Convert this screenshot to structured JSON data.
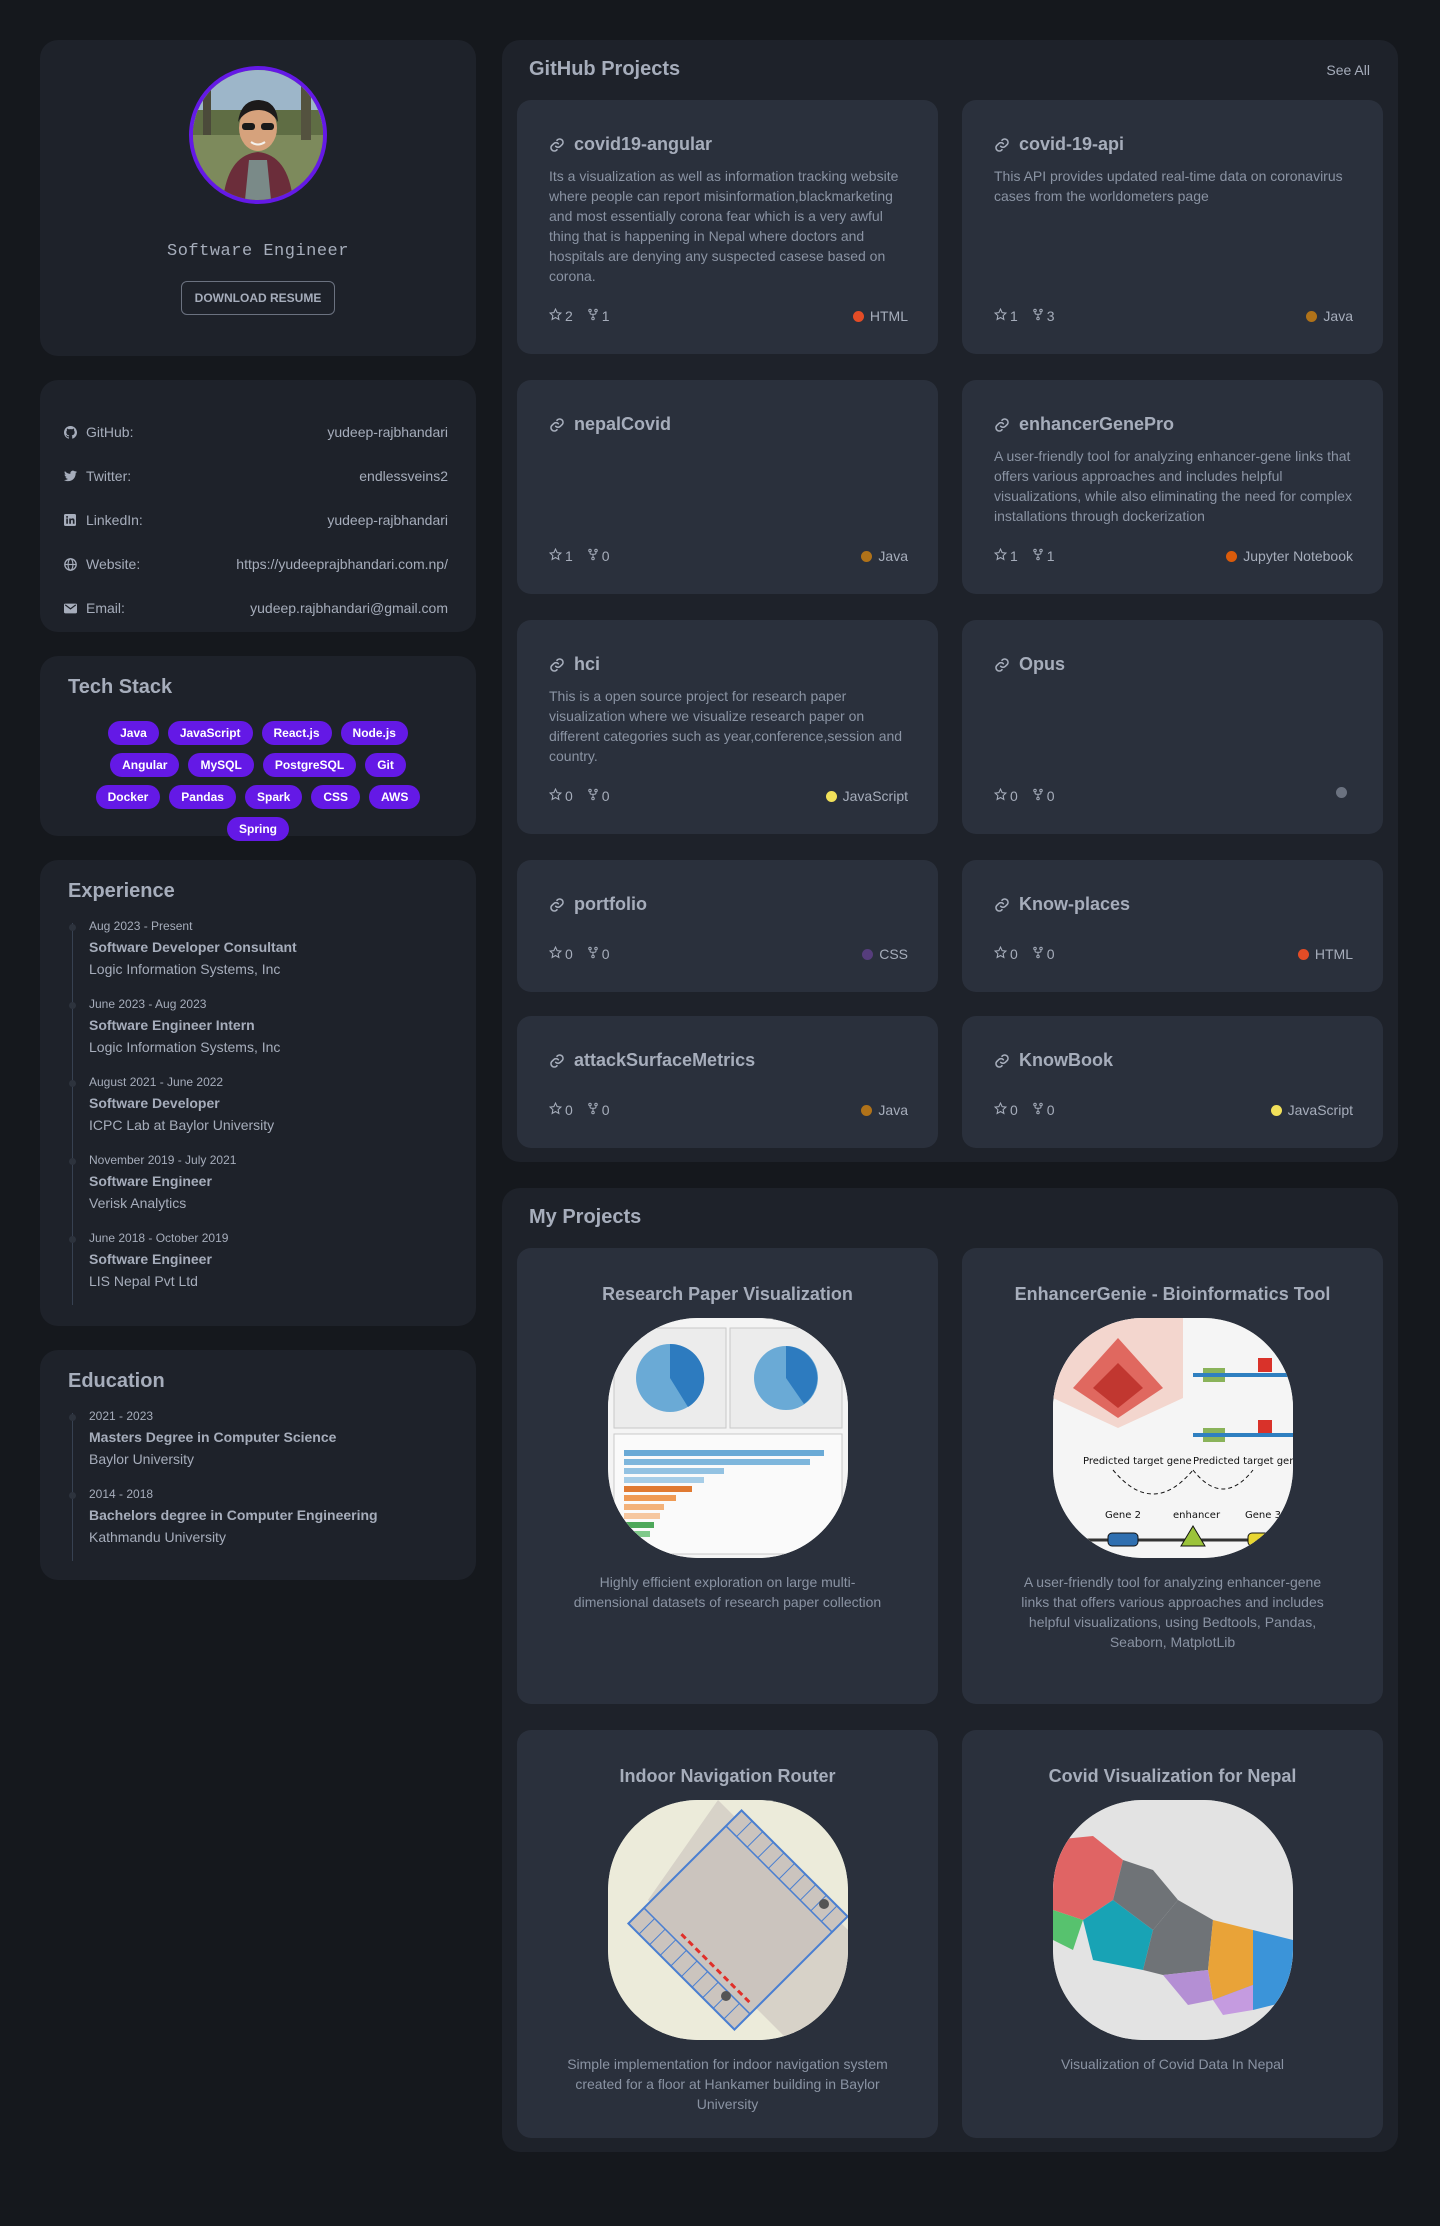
{
  "profile": {
    "role": "Software Engineer",
    "download_label": "DOWNLOAD RESUME"
  },
  "contacts": [
    {
      "icon": "github-icon",
      "label": "GitHub:",
      "value": "yudeep-rajbhandari"
    },
    {
      "icon": "twitter-icon",
      "label": "Twitter:",
      "value": "endlessveins2"
    },
    {
      "icon": "linkedin-icon",
      "label": "LinkedIn:",
      "value": "yudeep-rajbhandari"
    },
    {
      "icon": "globe-icon",
      "label": "Website:",
      "value": "https://yudeeprajbhandari.com.np/"
    },
    {
      "icon": "mail-icon",
      "label": "Email:",
      "value": "yudeep.rajbhandari@gmail.com"
    }
  ],
  "tech": {
    "title": "Tech Stack",
    "tags": [
      "Java",
      "JavaScript",
      "React.js",
      "Node.js",
      "Angular",
      "MySQL",
      "PostgreSQL",
      "Git",
      "Docker",
      "Pandas",
      "Spark",
      "CSS",
      "AWS",
      "Spring"
    ]
  },
  "experience": {
    "title": "Experience",
    "items": [
      {
        "date": "Aug 2023 - Present",
        "role": "Software Developer Consultant",
        "org": "Logic Information Systems, Inc"
      },
      {
        "date": "June 2023 - Aug 2023",
        "role": "Software Engineer Intern",
        "org": "Logic Information Systems, Inc"
      },
      {
        "date": "August 2021 - June 2022",
        "role": "Software Developer",
        "org": "ICPC Lab at Baylor University"
      },
      {
        "date": "November 2019 - July 2021",
        "role": "Software Engineer",
        "org": "Verisk Analytics"
      },
      {
        "date": "June 2018 - October 2019",
        "role": "Software Engineer",
        "org": "LIS Nepal Pvt Ltd"
      }
    ]
  },
  "education": {
    "title": "Education",
    "items": [
      {
        "date": "2021 - 2023",
        "role": "Masters Degree in Computer Science",
        "org": "Baylor University"
      },
      {
        "date": "2014 - 2018",
        "role": "Bachelors degree in Computer Engineering",
        "org": "Kathmandu University"
      }
    ]
  },
  "github": {
    "title": "GitHub Projects",
    "see_all": "See All",
    "repos": [
      {
        "name": "covid19-angular",
        "desc": "Its a visualization as well as information tracking website where people can report misinformation,blackmarketing and most essentially corona fear which is a very awful thing that is happening in Nepal where doctors and hospitals are denying any suspected casese based on corona.",
        "stars": "2",
        "forks": "1",
        "lang": "HTML",
        "color": "#e34c26"
      },
      {
        "name": "covid-19-api",
        "desc": "This API provides updated real-time data on coronavirus cases from the worldometers page",
        "stars": "1",
        "forks": "3",
        "lang": "Java",
        "color": "#b07219"
      },
      {
        "name": "nepalCovid",
        "desc": "",
        "stars": "1",
        "forks": "0",
        "lang": "Java",
        "color": "#b07219"
      },
      {
        "name": "enhancerGenePro",
        "desc": "A user-friendly tool for analyzing enhancer-gene links that offers various approaches and includes helpful visualizations, while also eliminating the need for complex installations through dockerization",
        "stars": "1",
        "forks": "1",
        "lang": "Jupyter Notebook",
        "color": "#da5b0b"
      },
      {
        "name": "hci",
        "desc": "This is a open source project for research paper visualization where we visualize research paper on different categories such as year,conference,session and country.",
        "stars": "0",
        "forks": "0",
        "lang": "JavaScript",
        "color": "#f1e05a"
      },
      {
        "name": "Opus",
        "desc": "",
        "stars": "0",
        "forks": "0",
        "lang": "",
        "color": "#6b7280"
      },
      {
        "name": "portfolio",
        "desc": "",
        "stars": "0",
        "forks": "0",
        "lang": "CSS",
        "color": "#563d7c"
      },
      {
        "name": "Know-places",
        "desc": "",
        "stars": "0",
        "forks": "0",
        "lang": "HTML",
        "color": "#e34c26"
      },
      {
        "name": "attackSurfaceMetrics",
        "desc": "",
        "stars": "0",
        "forks": "0",
        "lang": "Java",
        "color": "#b07219"
      },
      {
        "name": "KnowBook",
        "desc": "",
        "stars": "0",
        "forks": "0",
        "lang": "JavaScript",
        "color": "#f1e05a"
      }
    ]
  },
  "my_projects": {
    "title": "My Projects",
    "items": [
      {
        "title": "Research Paper Visualization",
        "desc": "Highly efficient exploration on large multi-dimensional datasets of research paper collection"
      },
      {
        "title": "EnhancerGenie - Bioinformatics Tool",
        "desc": "A user-friendly tool for analyzing enhancer-gene links that offers various approaches and includes helpful visualizations, using Bedtools, Pandas, Seaborn, MatplotLib",
        "figure_labels": [
          "Predicted target gene",
          "Predicted target gene",
          "Gene 2",
          "enhancer",
          "Gene 3"
        ]
      },
      {
        "title": "Indoor Navigation Router",
        "desc": "Simple implementation for indoor navigation system created for a floor at Hankamer building in Baylor University"
      },
      {
        "title": "Covid Visualization for Nepal",
        "desc": "Visualization of Covid Data In Nepal"
      }
    ]
  },
  "theme": {
    "accent": "#6419e6",
    "background": "#15181d",
    "card": "#1e222a",
    "inner_card": "#2a303c"
  }
}
